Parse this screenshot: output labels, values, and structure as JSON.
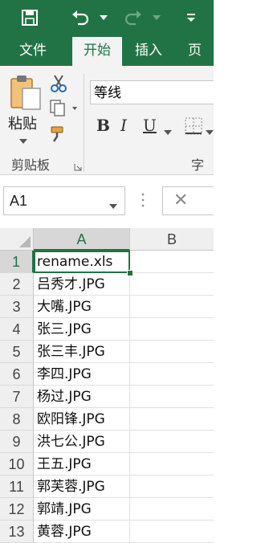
{
  "title_bar": {
    "icons": [
      "save-icon",
      "undo-icon",
      "redo-icon",
      "customize-quick-access-icon"
    ]
  },
  "tabs": [
    {
      "label": "文件",
      "active": false
    },
    {
      "label": "开始",
      "active": true
    },
    {
      "label": "插入",
      "active": false
    },
    {
      "label": "页面",
      "active": false
    }
  ],
  "ribbon": {
    "paste_label": "粘贴",
    "clipboard_group_label": "剪贴板",
    "font_name": "等线",
    "font_group_label": "字体",
    "bold": "B",
    "italic": "I",
    "underline": "U"
  },
  "formula_bar": {
    "name_box": "A1",
    "cancel_symbol": "✕"
  },
  "sheet": {
    "columns": [
      "A",
      "B"
    ],
    "selected_column": "A",
    "active_cell": "A1",
    "rows": [
      {
        "num": "1",
        "a": "rename.xls"
      },
      {
        "num": "2",
        "a": "吕秀才.JPG"
      },
      {
        "num": "3",
        "a": "大嘴.JPG"
      },
      {
        "num": "4",
        "a": "张三.JPG"
      },
      {
        "num": "5",
        "a": "张三丰.JPG"
      },
      {
        "num": "6",
        "a": "李四.JPG"
      },
      {
        "num": "7",
        "a": "杨过.JPG"
      },
      {
        "num": "8",
        "a": "欧阳锋.JPG"
      },
      {
        "num": "9",
        "a": "洪七公.JPG"
      },
      {
        "num": "10",
        "a": "王五.JPG"
      },
      {
        "num": "11",
        "a": "郭芙蓉.JPG"
      },
      {
        "num": "12",
        "a": "郭靖.JPG"
      },
      {
        "num": "13",
        "a": "黄蓉.JPG"
      }
    ]
  },
  "colors": {
    "brand_green": "#217346",
    "ribbon_bg": "#f3f3f3",
    "header_bg": "#efefef"
  }
}
